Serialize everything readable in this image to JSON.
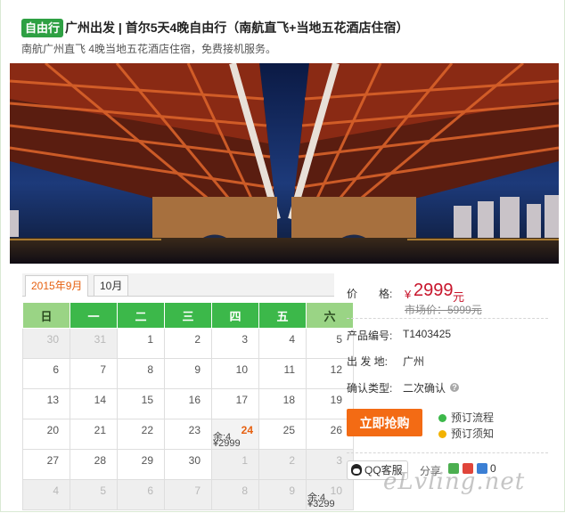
{
  "header": {
    "tag": "自由行",
    "title": "广州出发 | 首尔5天4晚自由行（南航直飞+当地五花酒店住宿）",
    "subtitle": "南航广州直飞 4晚当地五花酒店住宿，免费接机服务。"
  },
  "calendar": {
    "tabs": [
      {
        "label": "2015年9月",
        "active": true
      },
      {
        "label": "10月",
        "active": false
      }
    ],
    "weekdays": [
      "日",
      "一",
      "二",
      "三",
      "四",
      "五",
      "六"
    ],
    "rows": [
      [
        {
          "d": "30",
          "off": true
        },
        {
          "d": "31",
          "off": true
        },
        {
          "d": "1"
        },
        {
          "d": "2"
        },
        {
          "d": "3"
        },
        {
          "d": "4"
        },
        {
          "d": "5"
        }
      ],
      [
        {
          "d": "6"
        },
        {
          "d": "7"
        },
        {
          "d": "8"
        },
        {
          "d": "9"
        },
        {
          "d": "10"
        },
        {
          "d": "11"
        },
        {
          "d": "12"
        }
      ],
      [
        {
          "d": "13"
        },
        {
          "d": "14"
        },
        {
          "d": "15"
        },
        {
          "d": "16"
        },
        {
          "d": "17"
        },
        {
          "d": "18"
        },
        {
          "d": "19"
        }
      ],
      [
        {
          "d": "20"
        },
        {
          "d": "21"
        },
        {
          "d": "22"
        },
        {
          "d": "23"
        },
        {
          "d": "24",
          "stock": "余:4",
          "price": "¥2999"
        },
        {
          "d": "25"
        },
        {
          "d": "26"
        }
      ],
      [
        {
          "d": "27"
        },
        {
          "d": "28"
        },
        {
          "d": "29"
        },
        {
          "d": "30"
        },
        {
          "d": "1",
          "off": true
        },
        {
          "d": "2",
          "off": true
        },
        {
          "d": "3",
          "off": true
        }
      ],
      [
        {
          "d": "4",
          "off": true
        },
        {
          "d": "5",
          "off": true
        },
        {
          "d": "6",
          "off": true
        },
        {
          "d": "7",
          "off": true
        },
        {
          "d": "8",
          "off": true
        },
        {
          "d": "9",
          "off": true
        },
        {
          "d": "10",
          "off": true,
          "stock": "余:4",
          "price": "¥3299"
        }
      ]
    ]
  },
  "product": {
    "price_label": "价　　格:",
    "price_symbol": "¥",
    "price_value": "2999",
    "price_unit": "元",
    "market_price": "市场价：5999元",
    "code_label": "产品编号:",
    "code_value": "T1403425",
    "departure_label": "出 发 地:",
    "departure_value": "广州",
    "confirm_label": "确认类型:",
    "confirm_value": "二次确认",
    "help_icon": "?",
    "buy_label": "立即抢购",
    "booking_flow": "预订流程",
    "booking_notice": "预订须知",
    "qq_label": "QQ客服",
    "share_label": "分享",
    "share_count": "0"
  },
  "watermark": "eLvling.net",
  "colors": {
    "brand_green": "#3cb84a",
    "price_red": "#c8162c",
    "buy_orange": "#f36b14"
  }
}
